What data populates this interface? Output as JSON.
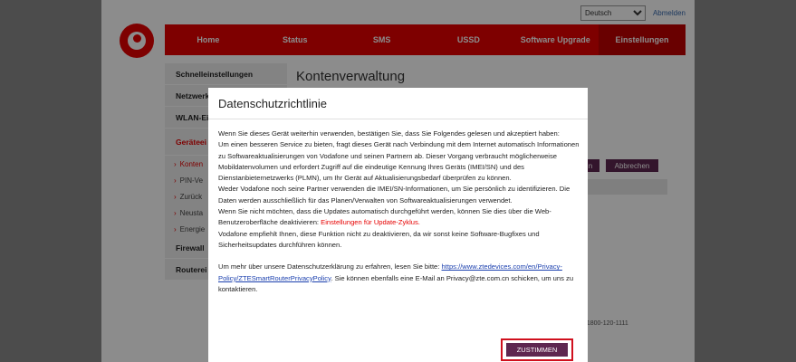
{
  "topbar": {
    "language": "Deutsch",
    "logout": "Abmelden"
  },
  "nav": {
    "items": [
      {
        "label": "Home"
      },
      {
        "label": "Status"
      },
      {
        "label": "SMS"
      },
      {
        "label": "USSD"
      },
      {
        "label": "Software Upgrade"
      },
      {
        "label": "Einstellungen"
      }
    ]
  },
  "sidebar": {
    "items": [
      {
        "label": "Schnelleinstellungen"
      },
      {
        "label": "Netzwerk"
      },
      {
        "label": "WLAN-Ei"
      },
      {
        "label": "Geräteei"
      }
    ],
    "subitems": [
      {
        "label": "Konten"
      },
      {
        "label": "PIN-Ve"
      },
      {
        "label": "Zurück"
      },
      {
        "label": "Neusta"
      },
      {
        "label": "Energie"
      }
    ],
    "bottom_items": [
      {
        "label": "Firewall"
      },
      {
        "label": "Routerei"
      }
    ]
  },
  "main": {
    "title": "Kontenverwaltung",
    "apply_partial": "n",
    "cancel_label": "Abbrechen",
    "phone_partial": "r. 1800-120-1111"
  },
  "modal": {
    "title": "Datenschutzrichtlinie",
    "p1": "Wenn Sie dieses Gerät weiterhin verwenden, bestätigen Sie, dass Sie Folgendes gelesen und akzeptiert haben:",
    "p2": "Um einen besseren Service zu bieten, fragt dieses Gerät nach Verbindung mit dem Internet automatisch Informationen zu Softwareaktualisierungen von Vodafone und seinen Partnern ab. Dieser Vorgang verbraucht möglicherweise Mobildatenvolumen und erfordert Zugriff auf die eindeutige Kennung Ihres Geräts (IMEI/SN) und des Dienstanbieternetzwerks (PLMN), um Ihr Gerät auf Aktualisierungsbedarf überprüfen zu können.",
    "p3": "Weder Vodafone noch seine Partner verwenden die IMEI/SN-Informationen, um Sie persönlich zu identifizieren. Die Daten werden ausschließlich für das Planen/Verwalten von Softwareaktualisierungen verwendet.",
    "p4_pre": "Wenn Sie nicht möchten, dass die Updates automatisch durchgeführt werden, können Sie dies über die Web-Benutzeroberfläche deaktivieren: ",
    "p4_link": "Einstellungen für Update-Zyklus.",
    "p5": "Vodafone empfiehlt Ihnen, diese Funktion nicht zu deaktivieren, da wir sonst keine Software-Bugfixes und Sicherheitsupdates durchführen können.",
    "p6_pre": "Um mehr über unsere Datenschutzerklärung zu erfahren, lesen Sie bitte: ",
    "p6_link": "https://www.ztedevices.com/en/Privacy-Policy/ZTESmartRouterPrivacyPolicy",
    "p6_post": ". Sie können ebenfalls eine E-Mail an Privacy@zte.com.cn schicken, um uns zu kontaktieren.",
    "agree_label": "ZUSTIMMEN"
  }
}
